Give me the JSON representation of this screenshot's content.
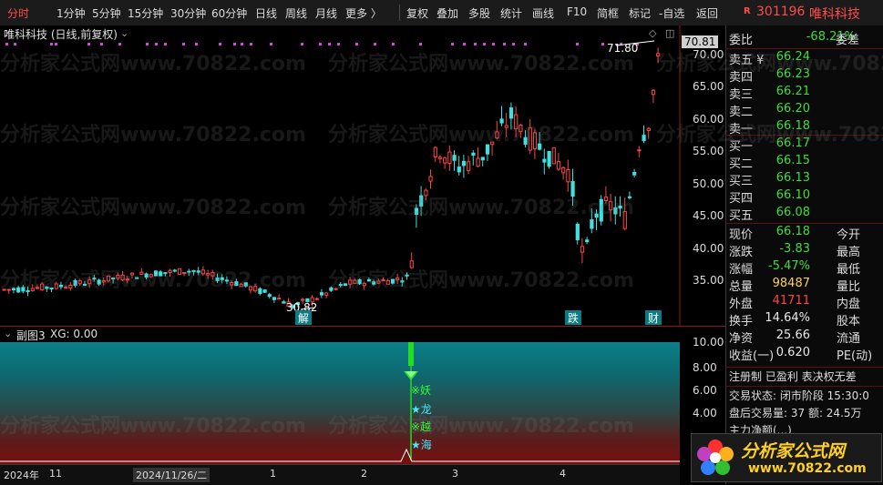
{
  "toolbar": {
    "periods": [
      "分时",
      "1分钟",
      "5分钟",
      "15分钟",
      "30分钟",
      "60分钟",
      "日线",
      "周线",
      "月线",
      "更多 〉"
    ],
    "tools": [
      "复权",
      "叠加",
      "多股",
      "统计",
      "画线",
      "F10",
      "简框",
      "标记",
      "-自选",
      "返回"
    ],
    "active_period": "分时"
  },
  "header": {
    "r_badge": "R",
    "code": "301196",
    "name": "唯科科技"
  },
  "main_chart": {
    "title": "唯科科技 (日线,前复权)",
    "y_ticks": [
      "70.00",
      "65.00",
      "60.00",
      "55.00",
      "50.00",
      "45.00",
      "40.00",
      "35.00"
    ],
    "price_tag": "70.81",
    "high_note": "71.80",
    "low_note": "30.82",
    "markers": [
      "解",
      "跌",
      "财"
    ]
  },
  "sub_chart": {
    "title": "副图3",
    "xg": "XG: 0.00",
    "y_ticks": [
      "10.00",
      "8.00",
      "6.00",
      "4.00"
    ],
    "signals": [
      "※妖",
      "★龙",
      "※越",
      "★海"
    ]
  },
  "date_axis": {
    "labels": [
      "2024年",
      "11",
      "2024/11/26/二",
      "1",
      "2",
      "3",
      "4"
    ]
  },
  "order_book": {
    "webi": {
      "label": "委比",
      "value": "-68.21%",
      "label2": "委差"
    },
    "sells": [
      {
        "label": "卖五 ¥",
        "price": "66.24"
      },
      {
        "label": "卖四",
        "price": "66.23"
      },
      {
        "label": "卖三",
        "price": "66.21"
      },
      {
        "label": "卖二",
        "price": "66.20"
      },
      {
        "label": "卖一",
        "price": "66.18"
      }
    ],
    "buys": [
      {
        "label": "买一",
        "price": "66.17"
      },
      {
        "label": "买二",
        "price": "66.15"
      },
      {
        "label": "买三",
        "price": "66.13"
      },
      {
        "label": "买四",
        "price": "66.10"
      },
      {
        "label": "买五",
        "price": "66.08"
      }
    ]
  },
  "quote": [
    {
      "label": "现价",
      "value": "66.18",
      "label2": "今开",
      "color": "green"
    },
    {
      "label": "涨跌",
      "value": "-3.83",
      "label2": "最高",
      "color": "green"
    },
    {
      "label": "涨幅",
      "value": "-5.47%",
      "label2": "最低",
      "color": "green"
    },
    {
      "label": "总量",
      "value": "98487",
      "label2": "量比",
      "color": "yellow"
    },
    {
      "label": "外盘",
      "value": "41711",
      "label2": "内盘",
      "color": "red"
    },
    {
      "label": "换手",
      "value": "14.64%",
      "label2": "股本",
      "color": "white"
    },
    {
      "label": "净资",
      "value": "25.66",
      "label2": "流通",
      "color": "white"
    },
    {
      "label": "收益(一)",
      "value": "0.620",
      "label2": "PE(动)",
      "color": "white"
    }
  ],
  "info": {
    "line1": "注册制  已盈利  表决权无差",
    "line2": "交易状态: 闭市阶段 15:30:0",
    "line3": "盘后交易量: 37 额: 24.5万",
    "line4": "主力净额(...)"
  },
  "logo": {
    "text": "分析家公式网",
    "url": "www.70822.com"
  },
  "watermark": "分析家公式网www.70822.com",
  "colors": {
    "up": "#ff4444",
    "down": "#3fe0e0",
    "bg": "#000000",
    "accent": "#ff4b4b"
  }
}
